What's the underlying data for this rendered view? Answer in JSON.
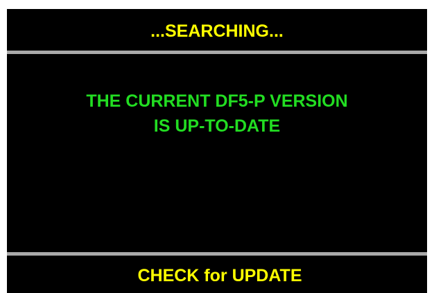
{
  "screen": {
    "title": "...SEARCHING...",
    "message": {
      "line1": "THE CURRENT DF5-P VERSION",
      "line2": "IS UP-TO-DATE"
    },
    "footer_button_label": "CHECK for UPDATE"
  },
  "colors": {
    "background": "#000000",
    "title_text": "#ffff00",
    "message_text": "#22dd22",
    "divider": "#a9a9a9",
    "outer_background": "#ffffff"
  }
}
